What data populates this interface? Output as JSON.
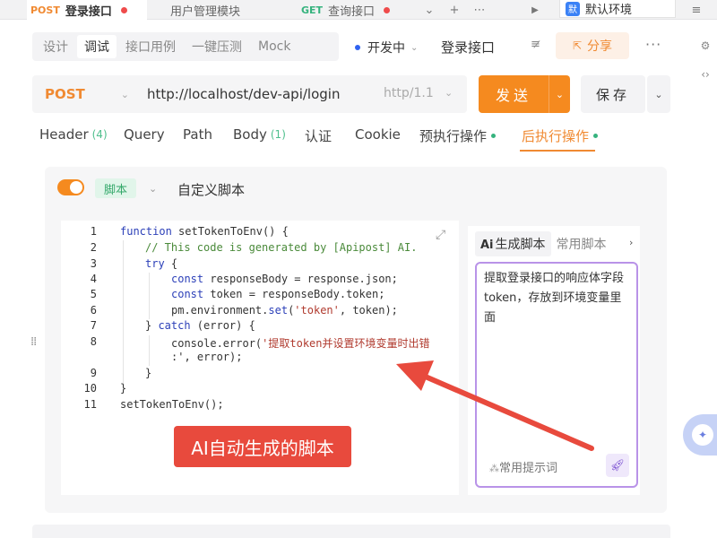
{
  "tabstrip": {
    "tabs": [
      {
        "method": "POST",
        "label": "登录接口",
        "method_color": "#f08a32",
        "active": true
      },
      {
        "method": "",
        "label": "用户管理模块",
        "active": false
      },
      {
        "method": "GET",
        "label": "查询接口",
        "method_color": "#36b37e",
        "active": false
      }
    ],
    "env_badge": "默",
    "env_label": "默认环境"
  },
  "modes": {
    "tabs": [
      "设计",
      "调试",
      "接口用例",
      "一键压测",
      "Mock"
    ],
    "active": "调试",
    "status": "开发中",
    "api_name": "登录接口",
    "share_label": "分享"
  },
  "request": {
    "method": "POST",
    "url": "http://localhost/dev-api/login",
    "protocol": "http/1.1",
    "send_label": "发送",
    "save_label": "保存"
  },
  "param_tabs": [
    {
      "label": "Header",
      "count": "(4)"
    },
    {
      "label": "Query",
      "count": ""
    },
    {
      "label": "Path",
      "count": ""
    },
    {
      "label": "Body",
      "count": "(1)"
    },
    {
      "label": "认证",
      "count": ""
    },
    {
      "label": "Cookie",
      "count": ""
    },
    {
      "label": "预执行操作",
      "count": ""
    },
    {
      "label": "后执行操作",
      "count": ""
    }
  ],
  "script": {
    "tag": "脚本",
    "title": "自定义脚本",
    "line_numbers": [
      "1",
      "2",
      "3",
      "4",
      "5",
      "6",
      "7",
      "8",
      "",
      "9",
      "10",
      "11"
    ],
    "code": {
      "l1_kw": "function",
      "l1_rest": " setTokenToEnv() {",
      "l2": "// This code is generated by [Apipost] AI.",
      "l3_kw": "try",
      "l3_rest": " {",
      "l4_kw": "const",
      "l4_rest": " responseBody = response.json;",
      "l5_kw": "const",
      "l5_rest": " token = responseBody.token;",
      "l6_a": "pm.environment.",
      "l6_kw": "set",
      "l6_b": "(",
      "l6_str": "'token'",
      "l6_c": ", token);",
      "l7_a": "} ",
      "l7_kw": "catch",
      "l7_b": " (error) {",
      "l8_a": "console.error(",
      "l8_str": "'提取token并设置环境变量时出错",
      "l8b": ":', error);",
      "l9": "}",
      "l10": "}",
      "l11": "setTokenToEnv();"
    }
  },
  "ai_panel": {
    "ai_mark": "Ai",
    "tab_generate": "生成脚本",
    "tab_common": "常用脚本",
    "prompt": "提取登录接口的响应体字段token，存放到环境变量里面",
    "hint": "常用提示词"
  },
  "annotation": {
    "label": "AI自动生成的脚本",
    "color": "#e84a3d"
  },
  "colors": {
    "accent": "#f58a1f",
    "ai_border": "#b993e8",
    "success": "#36b37e"
  }
}
